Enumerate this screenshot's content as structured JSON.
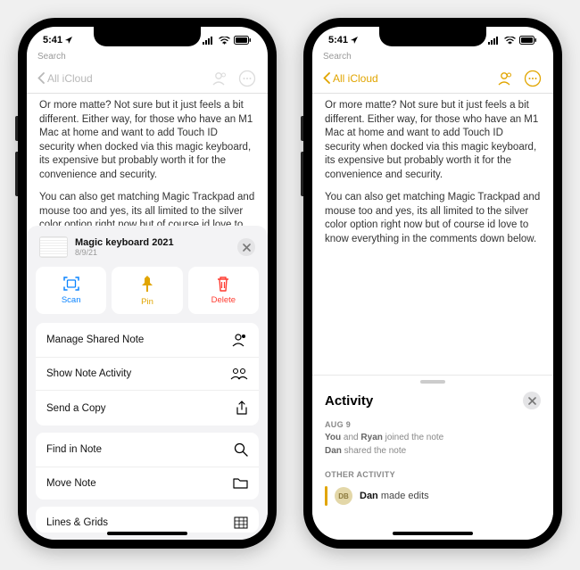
{
  "status": {
    "time": "5:41",
    "location_arrow": true
  },
  "nav": {
    "back_label": "All iCloud",
    "search_hint": "Search"
  },
  "note": {
    "para1": "Or more matte? Not sure but it just feels a bit different. Either way, for those who have an M1 Mac at home and want to add Touch ID security when docked via this magic keyboard, its expensive but probably worth it for the convenience and security.",
    "para2": "You can also get matching Magic Trackpad and mouse too and yes, its all limited to the silver color option right now but of course id love to know everything in the comments down below."
  },
  "sheet": {
    "title": "Magic keyboard 2021",
    "date": "8/9/21",
    "actions": {
      "scan": "Scan",
      "pin": "Pin",
      "delete": "Delete"
    },
    "menu": [
      "Manage Shared Note",
      "Show Note Activity",
      "Send a Copy",
      "Find in Note",
      "Move Note",
      "Lines & Grids"
    ]
  },
  "activity": {
    "title": "Activity",
    "section1": "AUG 9",
    "line1_you": "You",
    "line1_mid": " and ",
    "line1_name": "Ryan",
    "line1_rest": " joined the note",
    "line2_name": "Dan",
    "line2_rest": " shared the note",
    "section2": "OTHER ACTIVITY",
    "avatar_initials": "DB",
    "edit_name": "Dan",
    "edit_rest": " made edits"
  }
}
